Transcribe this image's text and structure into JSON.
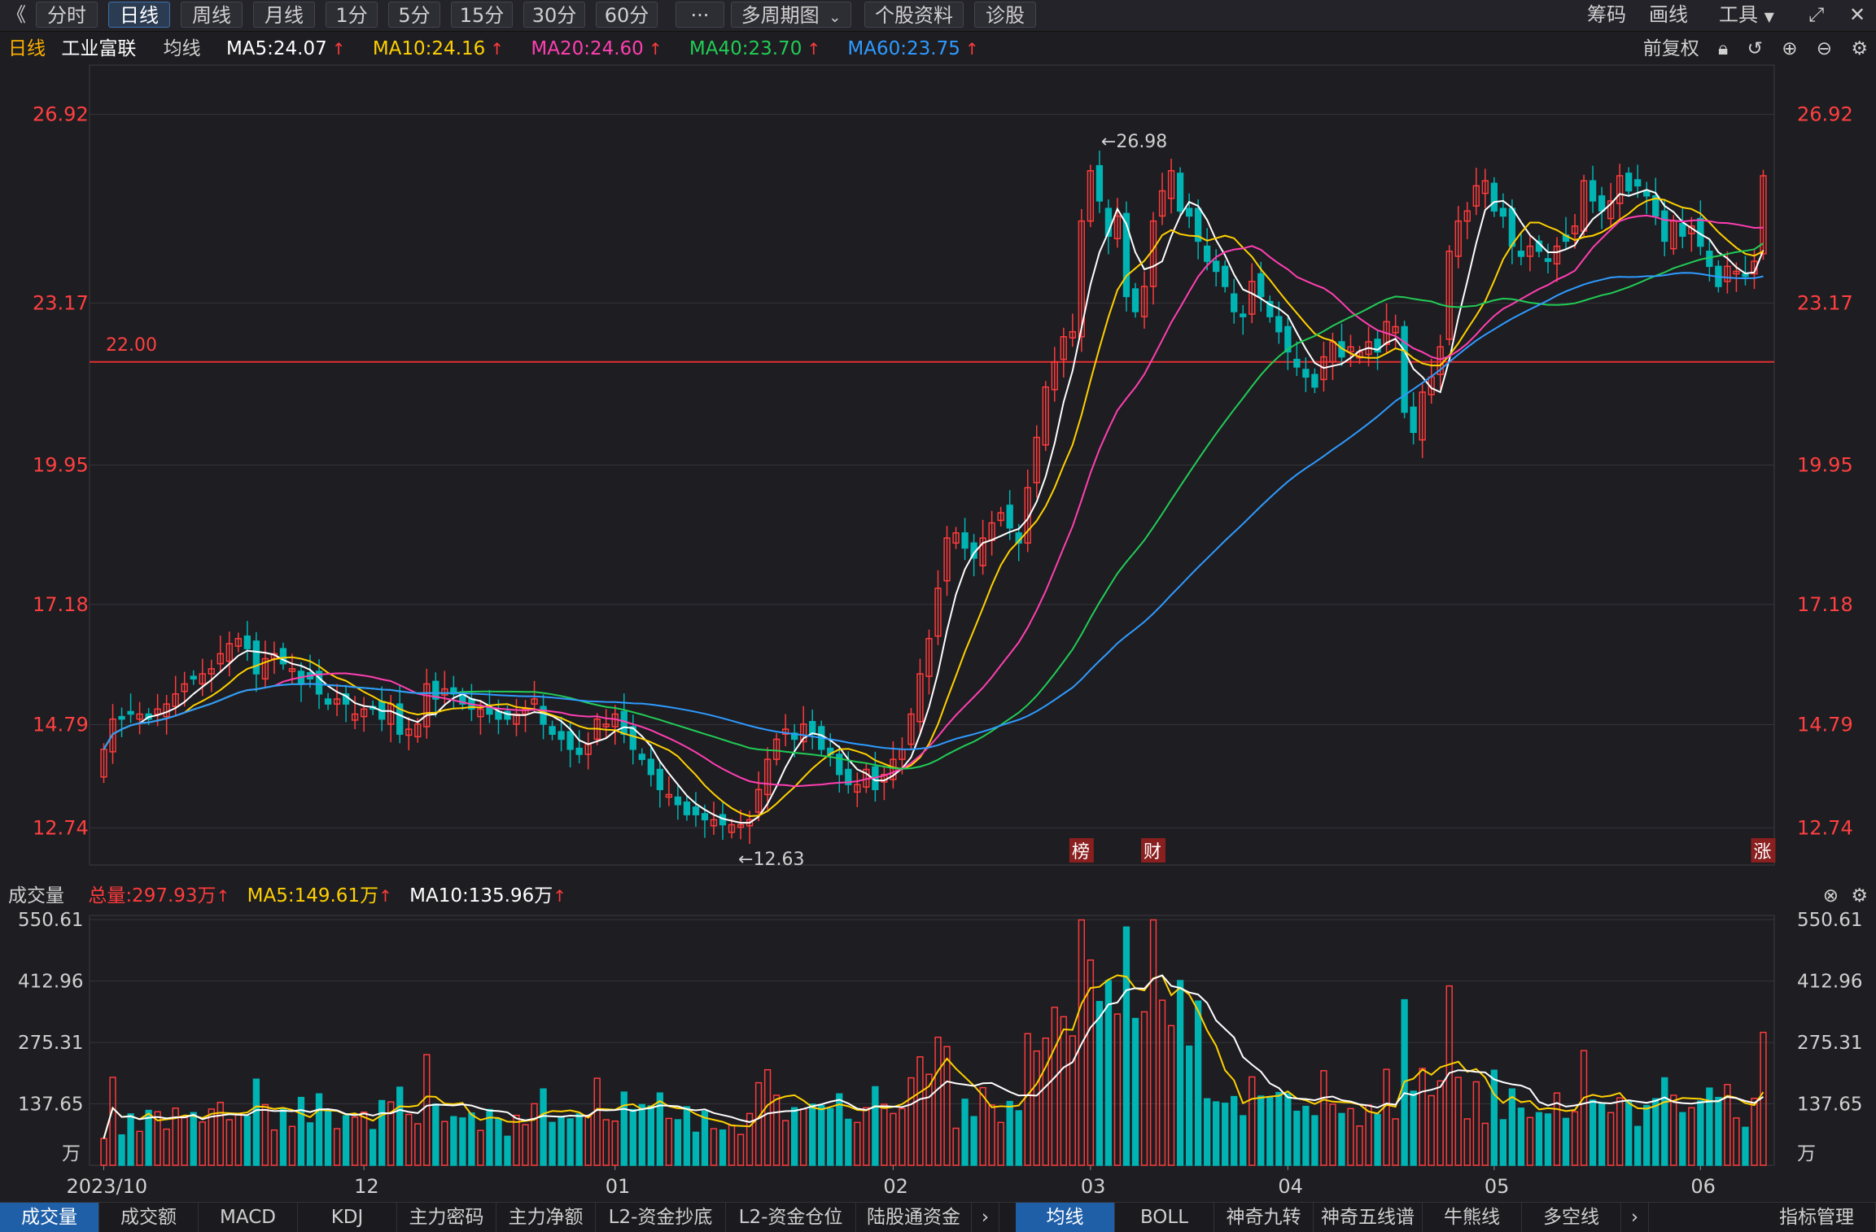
{
  "toolbar": {
    "back": "《",
    "periods": [
      "分时",
      "日线",
      "周线",
      "月线",
      "1分",
      "5分",
      "15分",
      "30分",
      "60分"
    ],
    "active_period": "日线",
    "more": "···",
    "multi_period": "多周期图",
    "stock_info": "个股资料",
    "diagnose": "诊股",
    "chips": "筹码",
    "draw": "画线",
    "tools": "工具"
  },
  "ma_line": {
    "period": "日线",
    "stock_name": "工业富联",
    "avg_label": "均线",
    "ma5": "MA5:24.07",
    "ma10": "MA10:24.16",
    "ma20": "MA20:24.60",
    "ma40": "MA40:23.70",
    "ma60": "MA60:23.75",
    "adjust": "前复权"
  },
  "volume_header": {
    "title": "成交量",
    "total": "总量:297.93万",
    "ma5": "MA5:149.61万",
    "ma10": "MA10:135.96万"
  },
  "colors": {
    "up": "#ff3b3b",
    "down": "#00b4b4",
    "ma5": "#ffffff",
    "ma10": "#ffd000",
    "ma20": "#ff3fb0",
    "ma40": "#22cc55",
    "ma60": "#2f9bff",
    "hline": "#e03030"
  },
  "bottom_tabs": {
    "left": [
      "成交量",
      "成交额",
      "MACD",
      "KDJ",
      "主力密码",
      "主力净额",
      "L2-资金抄底",
      "L2-资金仓位",
      "陆股通资金"
    ],
    "right": [
      "均线",
      "BOLL",
      "神奇九转",
      "神奇五线谱",
      "牛熊线",
      "多空线"
    ],
    "manage": "指标管理"
  },
  "chart_data": [
    {
      "type": "candlestick",
      "title": "工业富联 日线",
      "y_ticks": [
        "26.92",
        "23.17",
        "19.95",
        "17.18",
        "14.79",
        "12.74"
      ],
      "y_tick_values": [
        26.92,
        23.17,
        19.95,
        17.18,
        14.79,
        12.74
      ],
      "ylim": [
        12.0,
        27.9
      ],
      "horizontal_line": {
        "value": 22.0,
        "label": "22.00"
      },
      "high_annotation": "←26.98",
      "low_annotation": "←12.63",
      "markers": [
        "榜",
        "财",
        "涨"
      ],
      "x_labels": [
        "2023/10",
        "12",
        "01",
        "02",
        "03",
        "04",
        "05",
        "06"
      ],
      "series": [
        {
          "name": "MA5",
          "value": 24.07
        },
        {
          "name": "MA10",
          "value": 24.16
        },
        {
          "name": "MA20",
          "value": 24.6
        },
        {
          "name": "MA40",
          "value": 23.7
        },
        {
          "name": "MA60",
          "value": 23.75
        }
      ],
      "closes": [
        14.3,
        14.9,
        14.9,
        15.0,
        15.0,
        14.9,
        15.1,
        15.2,
        15.4,
        15.6,
        15.7,
        15.8,
        15.9,
        16.2,
        16.4,
        16.5,
        16.3,
        15.8,
        16.1,
        16.2,
        16.0,
        15.9,
        15.6,
        15.7,
        15.4,
        15.2,
        15.3,
        15.2,
        15.0,
        15.1,
        15.1,
        14.9,
        15.2,
        14.6,
        14.7,
        14.8,
        15.6,
        15.3,
        15.5,
        15.4,
        15.2,
        15.1,
        15.1,
        15.0,
        14.9,
        14.9,
        15.0,
        15.1,
        15.3,
        14.8,
        14.6,
        14.5,
        14.3,
        14.2,
        14.4,
        14.9,
        14.8,
        15.0,
        14.6,
        14.3,
        14.1,
        13.8,
        13.5,
        13.4,
        13.2,
        13.0,
        13.0,
        12.9,
        12.9,
        12.8,
        12.8,
        12.8,
        12.9,
        13.5,
        14.1,
        14.5,
        14.7,
        14.5,
        14.8,
        14.6,
        14.3,
        14.2,
        13.8,
        13.6,
        13.6,
        13.9,
        13.5,
        13.8,
        14.1,
        14.3,
        15.0,
        15.8,
        16.5,
        17.5,
        18.5,
        18.6,
        18.3,
        18.1,
        18.5,
        18.8,
        19.0,
        18.7,
        18.4,
        19.5,
        20.5,
        21.5,
        22.0,
        22.5,
        22.6,
        24.8,
        25.8,
        25.2,
        24.5,
        24.9,
        23.3,
        23.0,
        23.5,
        24.8,
        25.4,
        25.8,
        25.0,
        24.9,
        24.4,
        24.0,
        23.8,
        23.5,
        23.0,
        22.9,
        23.6,
        23.3,
        22.9,
        22.6,
        22.2,
        21.9,
        21.7,
        21.5,
        22.1,
        22.4,
        22.1,
        22.3,
        22.2,
        22.4,
        22.2,
        22.8,
        22.7,
        21.0,
        20.6,
        21.4,
        21.7,
        22.3,
        24.2,
        24.8,
        25.0,
        25.5,
        25.6,
        25.0,
        24.9,
        24.3,
        24.1,
        24.3,
        24.2,
        24.0,
        24.3,
        24.4,
        24.7,
        25.6,
        25.2,
        25.0,
        25.2,
        25.7,
        25.4,
        25.5,
        25.3,
        24.9,
        24.4,
        24.8,
        24.5,
        24.7,
        24.3,
        23.9,
        23.5,
        23.9,
        23.8,
        23.7,
        24.0,
        25.7
      ],
      "volume_unit": "万",
      "volume_y_ticks": [
        "550.61",
        "412.96",
        "275.31",
        "137.65"
      ],
      "volume_y_tick_values": [
        550.61,
        412.96,
        275.31,
        137.65
      ],
      "volume_ylim": [
        0,
        560
      ],
      "volume_total": 297.93,
      "volume_ma5": 149.61,
      "volume_ma10": 135.96
    }
  ]
}
